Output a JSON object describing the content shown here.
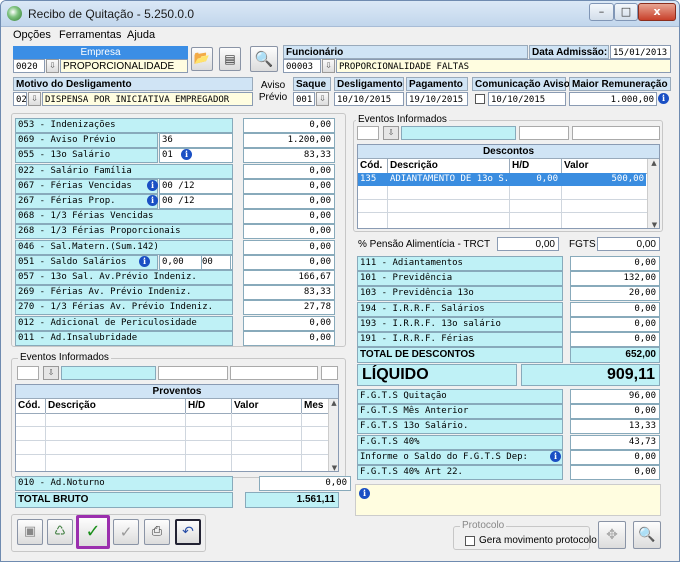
{
  "window": {
    "title": "Recibo de Quitação - 5.250.0.0",
    "min": "–",
    "max": "□",
    "close": "x"
  },
  "menu": [
    "Opções",
    "Ferramentas",
    "Ajuda"
  ],
  "empresa": {
    "label": "Empresa",
    "code": "0020",
    "name": "PROPORCIONALIDADE"
  },
  "funcionario": {
    "label": "Funcionário",
    "code": "00003",
    "name": "PROPORCIONALIDADE FALTAS"
  },
  "admissao": {
    "label": "Data Admissão:",
    "value": "15/01/2013"
  },
  "motivo": {
    "label": "Motivo do Desligamento",
    "code": "02",
    "text": "DISPENSA POR INICIATIVA EMPREGADOR"
  },
  "aviso": {
    "line1": "Aviso",
    "line2": "Prévio"
  },
  "saque": {
    "label": "Saque",
    "value": "001"
  },
  "desligamento": {
    "label": "Desligamento",
    "value": "10/10/2015"
  },
  "pagamento": {
    "label": "Pagamento",
    "value": "19/10/2015"
  },
  "comunicacao": {
    "label": "Comunicação Aviso",
    "value": "10/10/2015"
  },
  "maior": {
    "label": "Maior Remuneração",
    "value": "1.000,00"
  },
  "left_rows": [
    {
      "label": "053 - Indenizações",
      "value": "0,00"
    },
    {
      "label": "069 - Aviso Prévio",
      "extra": "36",
      "value": "1.200,00"
    },
    {
      "label": "055 - 13o Salário",
      "extra": "01",
      "value": "83,33"
    },
    {
      "label": "022 - Salário Família",
      "value": "0,00"
    },
    {
      "label": "067 - Férias Vencidas",
      "extra": "00 /12",
      "value": "0,00"
    },
    {
      "label": "267 - Férias Prop.",
      "extra": "00 /12",
      "value": "0,00"
    },
    {
      "label": "068 - 1/3 Férias Vencidas",
      "value": "0,00"
    },
    {
      "label": "268 - 1/3 Férias Proporcionais",
      "value": "0,00"
    },
    {
      "label": "046 - Sal.Matern.(Sum.142)",
      "value": "0,00"
    },
    {
      "label": "051 - Saldo Salários",
      "extra": "0,00",
      "extra2": "00",
      "value": "0,00"
    },
    {
      "label": "057 - 13o Sal. Av.Prévio Indeniz.",
      "value": "166,67"
    },
    {
      "label": "269 - Férias  Av. Prévio Indeniz.",
      "value": "83,33"
    },
    {
      "label": "270 - 1/3 Férias Av. Prévio Indeniz.",
      "value": "27,78"
    },
    {
      "label": "012 - Adicional de Periculosidade",
      "value": "0,00"
    },
    {
      "label": "011 - Ad.Insalubridade",
      "value": "0,00"
    }
  ],
  "eventos_left": {
    "title": "Eventos Informados"
  },
  "proventos": {
    "title": "Proventos",
    "cols": [
      "Cód.",
      "Descrição",
      "H/D",
      "Valor",
      "Mes"
    ]
  },
  "noturno": {
    "label": "010 - Ad.Noturno",
    "value": "0,00"
  },
  "total_bruto": {
    "label": "TOTAL BRUTO",
    "value": "1.561,11"
  },
  "eventos_right": {
    "title": "Eventos Informados"
  },
  "descontos": {
    "title": "Descontos",
    "cols": [
      "Cód.",
      "Descrição",
      "H/D",
      "Valor"
    ],
    "rows": [
      {
        "cod": "135",
        "desc": "ADIANTAMENTO DE 13o S.",
        "hd": "0,00",
        "valor": "500,00"
      }
    ]
  },
  "pensao": {
    "label": "% Pensão Alimentícia - TRCT",
    "value": "0,00"
  },
  "fgts_top": {
    "label": "FGTS",
    "value": "0,00"
  },
  "right_rows": [
    {
      "label": "111 - Adiantamentos",
      "value": "0,00"
    },
    {
      "label": "101 - Previdência",
      "value": "132,00"
    },
    {
      "label": "103 - Previdência 13o",
      "value": "20,00"
    },
    {
      "label": "194 - I.R.R.F. Salários",
      "value": "0,00"
    },
    {
      "label": "193 - I.R.R.F. 13o salário",
      "value": "0,00"
    },
    {
      "label": "191 - I.R.R.F. Férias",
      "value": "0,00"
    }
  ],
  "total_descontos": {
    "label": "TOTAL DE DESCONTOS",
    "value": "652,00"
  },
  "liquido": {
    "label": "LÍQUIDO",
    "value": "909,11"
  },
  "fgts_rows": [
    {
      "label": "F.G.T.S  Quitação",
      "value": "96,00"
    },
    {
      "label": "F.G.T.S  Mês Anterior",
      "value": "0,00"
    },
    {
      "label": "F.G.T.S  13o Salário.",
      "value": "13,33"
    },
    {
      "label": "F.G.T.S  40%",
      "value": "43,73"
    },
    {
      "label": "Informe o Saldo do F.G.T.S Dep:",
      "value": "0,00"
    },
    {
      "label": "F.G.T.S  40% Art 22.",
      "value": "0,00"
    }
  ],
  "protocolo": {
    "title": "Protocolo",
    "checkbox": "Gera movimento protocolo"
  }
}
